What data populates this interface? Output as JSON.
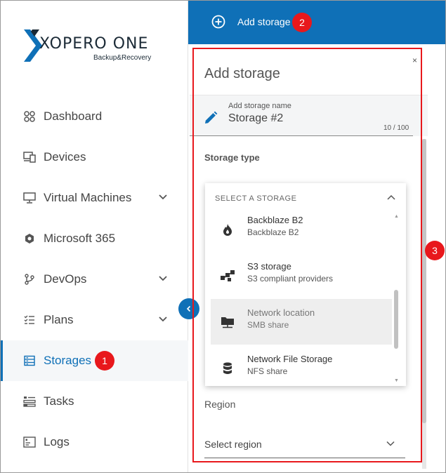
{
  "brand": {
    "name": "XOPERO ONE",
    "tagline": "Backup&Recovery",
    "color": "#0f70b7"
  },
  "sidebar": {
    "items": [
      {
        "label": "Dashboard",
        "icon": "dashboard-icon"
      },
      {
        "label": "Devices",
        "icon": "devices-icon"
      },
      {
        "label": "Virtual Machines",
        "icon": "monitor-icon",
        "expandable": true
      },
      {
        "label": "Microsoft 365",
        "icon": "office-icon"
      },
      {
        "label": "DevOps",
        "icon": "branch-icon",
        "expandable": true
      },
      {
        "label": "Plans",
        "icon": "checklist-icon",
        "expandable": true
      },
      {
        "label": "Storages",
        "icon": "storage-icon",
        "active": true
      },
      {
        "label": "Tasks",
        "icon": "tasks-icon"
      },
      {
        "label": "Logs",
        "icon": "logs-icon"
      }
    ]
  },
  "topbar": {
    "add_label": "Add storage"
  },
  "panel": {
    "title": "Add storage",
    "close": "×",
    "name_field": {
      "label": "Add storage name",
      "value": "Storage #2",
      "counter": "10 / 100"
    },
    "storage_type_label": "Storage type",
    "dropdown": {
      "placeholder": "SELECT A STORAGE",
      "options": [
        {
          "title": "Backblaze B2",
          "subtitle": "Backblaze B2",
          "icon": "flame-icon"
        },
        {
          "title": "S3 storage",
          "subtitle": "S3 compliant providers",
          "icon": "s3-icon"
        },
        {
          "title": "Network location",
          "subtitle": "SMB share",
          "icon": "folder-icon",
          "highlighted": true
        },
        {
          "title": "Network File Storage",
          "subtitle": "NFS share",
          "icon": "database-icon"
        }
      ]
    },
    "region_label": "Region",
    "region_select": {
      "value": "Select region"
    }
  },
  "annotations": {
    "badge_1": "1",
    "badge_2": "2",
    "badge_3": "3",
    "color": "#e8181c"
  }
}
